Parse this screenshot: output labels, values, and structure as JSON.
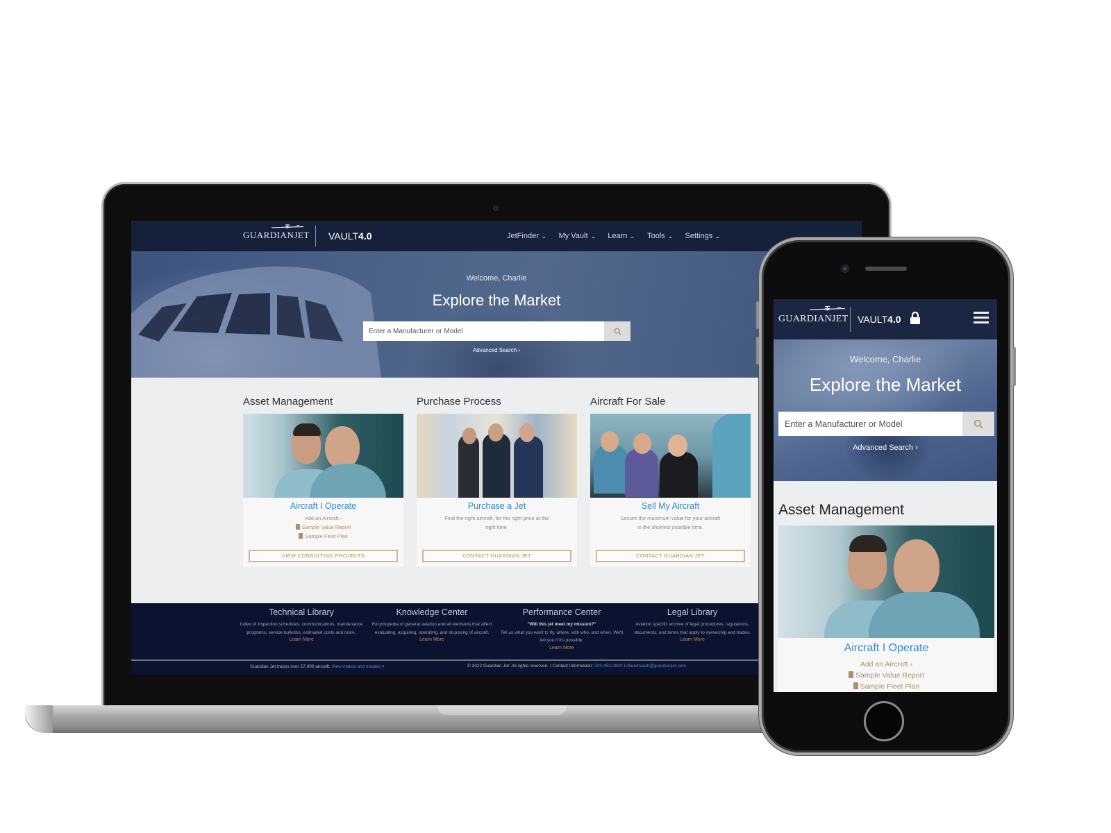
{
  "brand": {
    "logo_text": "GuardianJet",
    "product_name": "VAULT",
    "product_version": "4.0"
  },
  "colors": {
    "nav_bg": "#15203a",
    "footer_bg": "#0b1330",
    "accent_blue": "#3a87c6",
    "accent_gold": "#a8926b",
    "page_bg": "#eceef0"
  },
  "laptop": {
    "nav": {
      "items": [
        {
          "label": "JetFinder",
          "icon": "chevron-down-icon"
        },
        {
          "label": "My Vault",
          "icon": "chevron-down-icon"
        },
        {
          "label": "Learn",
          "icon": "chevron-down-icon"
        },
        {
          "label": "Tools",
          "icon": "chevron-down-icon"
        },
        {
          "label": "Settings",
          "icon": "chevron-down-icon"
        }
      ]
    },
    "hero": {
      "welcome": "Welcome, Charlie",
      "title": "Explore the Market",
      "search_placeholder": "Enter a Manufacturer or Model",
      "search_value": "",
      "search_icon": "search-icon",
      "advanced_search": "Advanced Search ›"
    },
    "cards": [
      {
        "heading": "Asset Management",
        "subtitle": "Aircraft I Operate",
        "links": [
          "Add an Aircraft ›",
          "Sample Value Report",
          "Sample Fleet Plan"
        ],
        "text": "",
        "cta": "VIEW CONSULTING PROJECTS"
      },
      {
        "heading": "Purchase Process",
        "subtitle": "Purchase a Jet",
        "links": [],
        "text": "Find the right aircraft, for the right price at the right time.",
        "cta": "CONTACT GUARDIAN JET"
      },
      {
        "heading": "Aircraft For Sale",
        "subtitle": "Sell My Aircraft",
        "links": [],
        "text": "Secure the maximum value for your aircraft in the shortest possible time.",
        "cta": "CONTACT GUARDIAN JET"
      }
    ],
    "footer": {
      "columns": [
        {
          "title": "Technical Library",
          "lead": "",
          "text": "Index of inspection schedules, communications, maintenance programs, service bulletins, estimated costs and more.",
          "link": "Learn More"
        },
        {
          "title": "Knowledge Center",
          "lead": "",
          "text": "Encyclopedia of general aviation and all elements that affect evaluating, acquiring, operating, and disposing of aircraft.",
          "link": "Learn More"
        },
        {
          "title": "Performance Center",
          "lead": "\"Will this jet meet my mission?\"",
          "text": "Tell us what you want to fly, where, with who, and when. We'll tell you if it's possible.",
          "link": "Learn More"
        },
        {
          "title": "Legal Library",
          "lead": "",
          "text": "Aviation specific archive of legal procedures, regulations, documents, and terms that apply to ownership and trades.",
          "link": "Learn More"
        }
      ],
      "tracks_text": "Guardian Jet tracks over 27,000 aircraft.",
      "tracks_link": "View makes and models ▾",
      "copyright": "© 2022 Guardian Jet. All rights reserved. I Contact Information:",
      "phone": "203-453-0800",
      "separator": " I ",
      "email": "diteamvault@guardianjet.com"
    }
  },
  "phone": {
    "hero": {
      "welcome": "Welcome, Charlie",
      "title": "Explore the Market",
      "search_placeholder": "Enter a Manufacturer or Model",
      "search_value": "",
      "advanced_search": "Advanced Search ›"
    },
    "section_heading": "Asset Management",
    "card": {
      "subtitle": "Aircraft I Operate",
      "links": [
        "Add an Aircraft ›",
        "Sample Value Report",
        "Sample Fleet Plan"
      ]
    }
  }
}
